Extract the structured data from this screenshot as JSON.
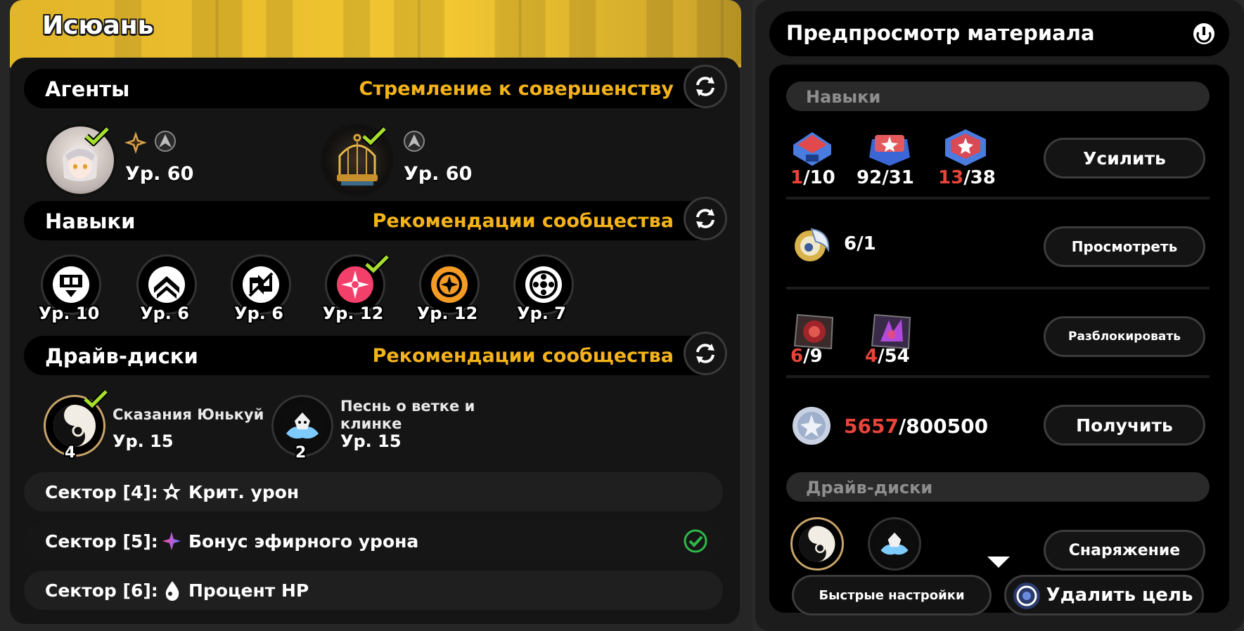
{
  "character": {
    "name": "Исюань"
  },
  "agents": {
    "title": "Агенты",
    "recommendation": "Стремление к совершенству",
    "items": [
      {
        "level": "Ур. 60"
      },
      {
        "level": "Ур. 60"
      }
    ]
  },
  "skills": {
    "title": "Навыки",
    "recommendation": "Рекомендации сообщества",
    "items": [
      {
        "level": "Ур. 10"
      },
      {
        "level": "Ур. 6"
      },
      {
        "level": "Ур. 6"
      },
      {
        "level": "Ур. 12"
      },
      {
        "level": "Ур. 12"
      },
      {
        "level": "Ур. 7"
      }
    ]
  },
  "drives": {
    "title": "Драйв-диски",
    "recommendation": "Рекомендации сообщества",
    "sets": [
      {
        "name": "Сказания Юнькуй",
        "level": "Ур. 15",
        "count": "4"
      },
      {
        "name": "Песнь о ветке и клинке",
        "level": "Ур. 15",
        "count": "2"
      }
    ],
    "sectors": [
      {
        "label": "Сектор [4]:",
        "stat": "Крит. урон"
      },
      {
        "label": "Сектор [5]:",
        "stat": "Бонус эфирного урона"
      },
      {
        "label": "Сектор [6]:",
        "stat": "Процент HP"
      }
    ]
  },
  "preview": {
    "title": "Предпросмотр материала",
    "skills_group": "Навыки",
    "drives_group": "Драйв-диски",
    "skill_mats": [
      {
        "have": "1",
        "need": "/10",
        "short": true
      },
      {
        "have": "92",
        "need": "/31",
        "short": false
      },
      {
        "have": "13",
        "need": "/38",
        "short": true
      }
    ],
    "core_mat": {
      "have": "6",
      "need": "/1"
    },
    "boss_mats": [
      {
        "have": "6",
        "need": "/9"
      },
      {
        "have": "4",
        "need": "/54"
      }
    ],
    "coin": {
      "have": "5657",
      "need": "/800500"
    },
    "buttons": {
      "enhance": "Усилить",
      "view": "Просмотреть",
      "unlock": "Разблокировать",
      "get": "Получить",
      "equip": "Снаряжение",
      "quick": "Быстрые настройки",
      "remove": "Удалить цель"
    }
  },
  "colors": {
    "accent": "#f4b31a",
    "deficit": "#e8453a",
    "check": "#a6e02c",
    "ok": "#2fb84a"
  }
}
